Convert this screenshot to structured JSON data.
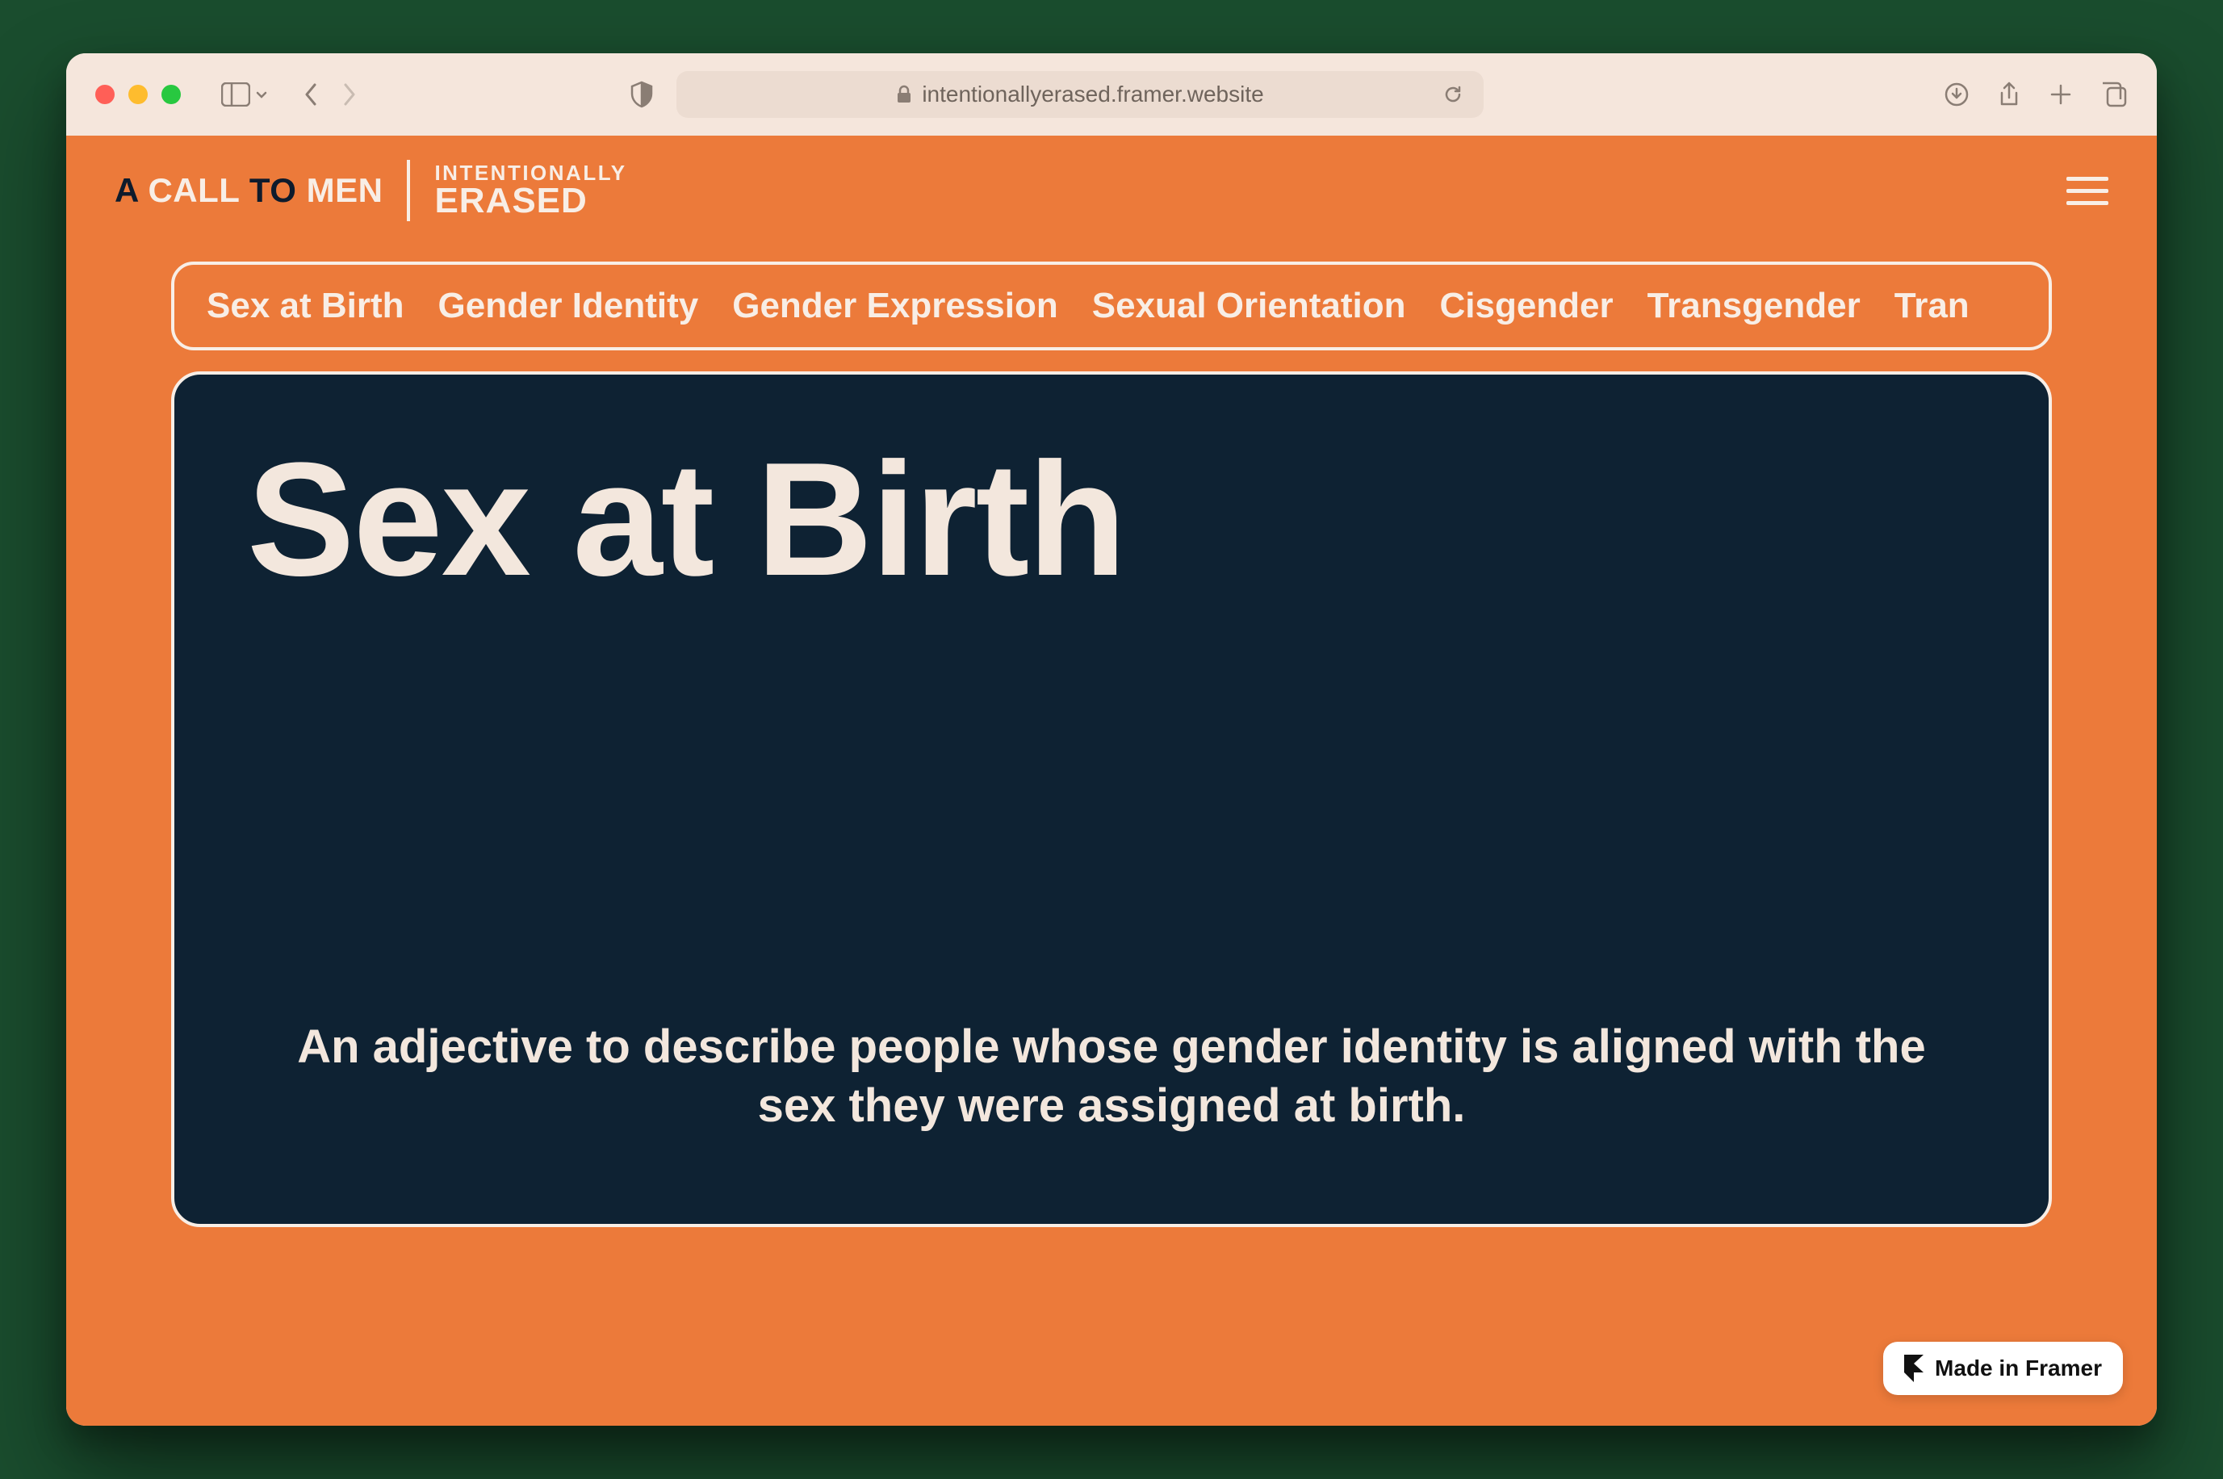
{
  "browser": {
    "url": "intentionallyerased.framer.website"
  },
  "header": {
    "logo1": {
      "a": "A",
      "call": "CALL",
      "to": "TO",
      "men": "MEN"
    },
    "logo2": {
      "top": "INTENTIONALLY",
      "bot": "ERASED"
    }
  },
  "tabs": [
    "Sex at Birth",
    "Gender Identity",
    "Gender Expression",
    "Sexual Orientation",
    "Cisgender",
    "Transgender",
    "Tran"
  ],
  "card": {
    "title": "Sex at Birth",
    "body": "An adjective to describe people whose gender identity is aligned with the sex they were assigned at birth."
  },
  "badge": {
    "label": "Made in Framer"
  },
  "colors": {
    "accent": "#ec7a3a",
    "card_bg": "#0e2233",
    "cream": "#f8eee6"
  }
}
